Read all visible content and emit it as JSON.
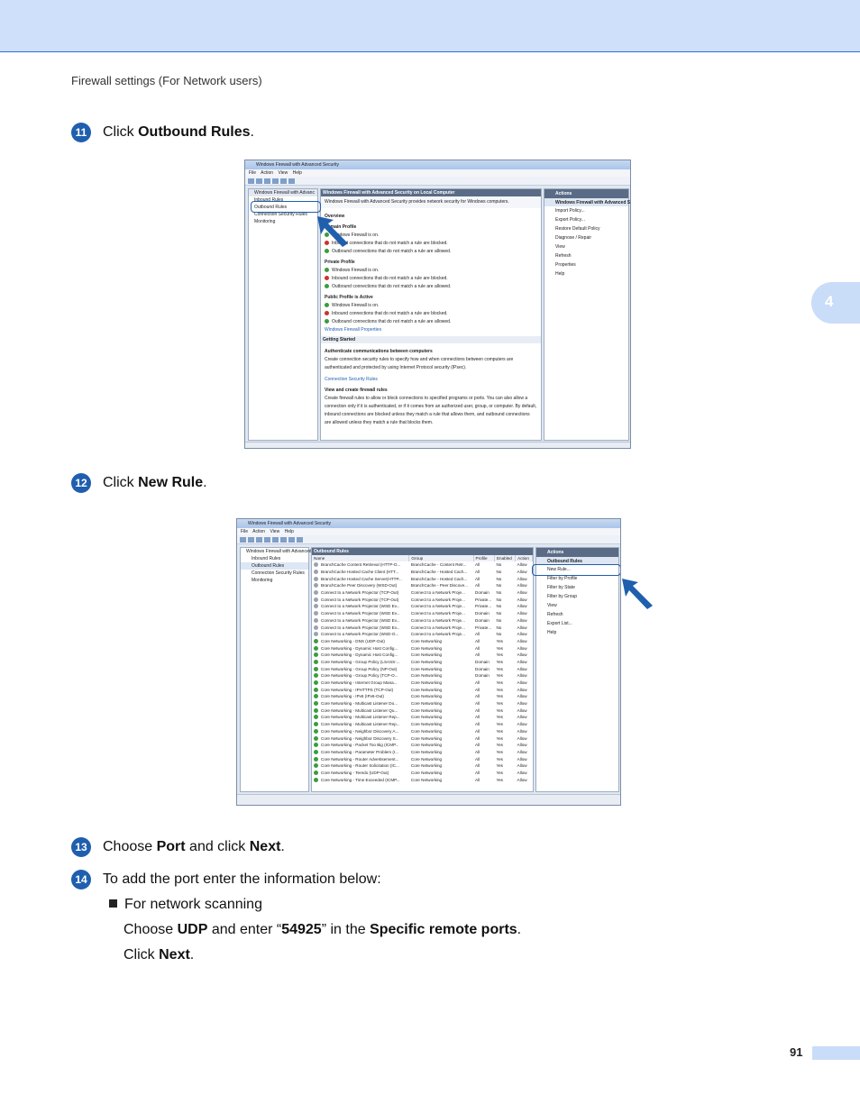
{
  "header": {
    "running_title": "Firewall settings (For Network users)",
    "chapter_tab": "4",
    "page_number": "91"
  },
  "steps": [
    {
      "num": "11",
      "text_pre": "Click ",
      "text_bold": "Outbound Rules",
      "text_post": "."
    },
    {
      "num": "12",
      "text_pre": "Click ",
      "text_bold": "New Rule",
      "text_post": "."
    },
    {
      "num": "13",
      "text_pre": "Choose ",
      "text_bold": "Port",
      "text_mid": " and click ",
      "text_bold2": "Next",
      "text_post": "."
    },
    {
      "num": "14",
      "text": "To add the port enter the information below:"
    }
  ],
  "bullet": {
    "label": "For network scanning",
    "line1_pre": "Choose ",
    "line1_b1": "UDP",
    "line1_mid": " and enter “",
    "line1_b2": "54925",
    "line1_mid2": "” in the ",
    "line1_b3": "Specific remote ports",
    "line1_post": ".",
    "line2_pre": "Click ",
    "line2_b": "Next",
    "line2_post": "."
  },
  "shot1": {
    "title": "Windows Firewall with Advanced Security",
    "menu": "File  Action  View  Help",
    "tree_head": "Windows Firewall with Advanc",
    "tree": [
      "Inbound Rules",
      "Outbound Rules",
      "Connection Security Rules",
      "Monitoring"
    ],
    "center_head": "Windows Firewall with Advanced Security on Local Computer",
    "banner": "Windows Firewall with Advanced Security provides network security for Windows computers.",
    "overview": "Overview",
    "domain": "Domain Profile",
    "private": "Private Profile",
    "public": "Public Profile is Active",
    "on": "Windows Firewall is on.",
    "inb": "Inbound connections that do not match a rule are blocked.",
    "outb": "Outbound connections that do not match a rule are allowed.",
    "props": "Windows Firewall Properties",
    "gs": "Getting Started",
    "auth": "Authenticate communications between computers",
    "auth_txt": "Create connection security rules to specify how and when connections between computers are authenticated and protected by using Internet Protocol security (IPsec).",
    "csr": "Connection Security Rules",
    "view": "View and create firewall rules",
    "view_txt": "Create firewall rules to allow or block connections to specified programs or ports. You can also allow a connection only if it is authenticated, or if it comes from an authorized user, group, or computer. By default, inbound connections are blocked unless they match a rule that allows them, and outbound connections are allowed unless they match a rule that blocks them.",
    "actions_head": "Actions",
    "actions_sub": "Windows Firewall with Advanced Se...",
    "actions": [
      "Import Policy...",
      "Export Policy...",
      "Restore Default Policy",
      "Diagnose / Repair",
      "View",
      "Refresh",
      "Properties",
      "Help"
    ]
  },
  "shot2": {
    "title": "Windows Firewall with Advanced Security",
    "menu": "File  Action  View  Help",
    "tree": [
      "Windows Firewall with Advanced",
      "Inbound Rules",
      "Outbound Rules",
      "Connection Security Rules",
      "Monitoring"
    ],
    "center_head": "Outbound Rules",
    "cols": [
      "Name",
      "Group",
      "Profile",
      "Enabled",
      "Action"
    ],
    "rows": [
      [
        "BranchCache Content Retrieval (HTTP-O...",
        "BranchCache - Content Retr...",
        "All",
        "No",
        "Allow"
      ],
      [
        "BranchCache Hosted Cache Client (HTT...",
        "BranchCache - Hosted Cach...",
        "All",
        "No",
        "Allow"
      ],
      [
        "BranchCache Hosted Cache Server(HTTP...",
        "BranchCache - Hosted Cach...",
        "All",
        "No",
        "Allow"
      ],
      [
        "BranchCache Peer Discovery (WSD-Out)",
        "BranchCache - Peer Discove...",
        "All",
        "No",
        "Allow"
      ],
      [
        "Connect to a Network Projector (TCP-Out)",
        "Connect to a Network Proje...",
        "Domain",
        "No",
        "Allow"
      ],
      [
        "Connect to a Network Projector (TCP-Out)",
        "Connect to a Network Proje...",
        "Private...",
        "No",
        "Allow"
      ],
      [
        "Connect to a Network Projector (WSD Ev...",
        "Connect to a Network Proje...",
        "Private...",
        "No",
        "Allow"
      ],
      [
        "Connect to a Network Projector (WSD Ev...",
        "Connect to a Network Proje...",
        "Domain",
        "No",
        "Allow"
      ],
      [
        "Connect to a Network Projector (WSD Ev...",
        "Connect to a Network Proje...",
        "Domain",
        "No",
        "Allow"
      ],
      [
        "Connect to a Network Projector (WSD Ev...",
        "Connect to a Network Proje...",
        "Private...",
        "No",
        "Allow"
      ],
      [
        "Connect to a Network Projector (WSD-O...",
        "Connect to a Network Proje...",
        "All",
        "No",
        "Allow"
      ],
      [
        "Core Networking - DNS (UDP-Out)",
        "Core Networking",
        "All",
        "Yes",
        "Allow"
      ],
      [
        "Core Networking - Dynamic Host Config...",
        "Core Networking",
        "All",
        "Yes",
        "Allow"
      ],
      [
        "Core Networking - Dynamic Host Config...",
        "Core Networking",
        "All",
        "Yes",
        "Allow"
      ],
      [
        "Core Networking - Group Policy (LSASS-...",
        "Core Networking",
        "Domain",
        "Yes",
        "Allow"
      ],
      [
        "Core Networking - Group Policy (NP-Out)",
        "Core Networking",
        "Domain",
        "Yes",
        "Allow"
      ],
      [
        "Core Networking - Group Policy (TCP-O...",
        "Core Networking",
        "Domain",
        "Yes",
        "Allow"
      ],
      [
        "Core Networking - Internet Group Mana...",
        "Core Networking",
        "All",
        "Yes",
        "Allow"
      ],
      [
        "Core Networking - IPHTTPS (TCP-Out)",
        "Core Networking",
        "All",
        "Yes",
        "Allow"
      ],
      [
        "Core Networking - IPv6 (IPv6-Out)",
        "Core Networking",
        "All",
        "Yes",
        "Allow"
      ],
      [
        "Core Networking - Multicast Listener Do...",
        "Core Networking",
        "All",
        "Yes",
        "Allow"
      ],
      [
        "Core Networking - Multicast Listener Qu...",
        "Core Networking",
        "All",
        "Yes",
        "Allow"
      ],
      [
        "Core Networking - Multicast Listener Rep...",
        "Core Networking",
        "All",
        "Yes",
        "Allow"
      ],
      [
        "Core Networking - Multicast Listener Rep...",
        "Core Networking",
        "All",
        "Yes",
        "Allow"
      ],
      [
        "Core Networking - Neighbor Discovery A...",
        "Core Networking",
        "All",
        "Yes",
        "Allow"
      ],
      [
        "Core Networking - Neighbor Discovery S...",
        "Core Networking",
        "All",
        "Yes",
        "Allow"
      ],
      [
        "Core Networking - Packet Too Big (ICMP...",
        "Core Networking",
        "All",
        "Yes",
        "Allow"
      ],
      [
        "Core Networking - Parameter Problem (I...",
        "Core Networking",
        "All",
        "Yes",
        "Allow"
      ],
      [
        "Core Networking - Router Advertisement...",
        "Core Networking",
        "All",
        "Yes",
        "Allow"
      ],
      [
        "Core Networking - Router Solicitation (IC...",
        "Core Networking",
        "All",
        "Yes",
        "Allow"
      ],
      [
        "Core Networking - Teredo (UDP-Out)",
        "Core Networking",
        "All",
        "Yes",
        "Allow"
      ],
      [
        "Core Networking - Time Exceeded (ICMP...",
        "Core Networking",
        "All",
        "Yes",
        "Allow"
      ]
    ],
    "actions_head": "Actions",
    "actions_sub": "Outbound Rules",
    "actions": [
      "New Rule...",
      "Filter by Profile",
      "Filter by State",
      "Filter by Group",
      "View",
      "Refresh",
      "Export List...",
      "Help"
    ]
  }
}
